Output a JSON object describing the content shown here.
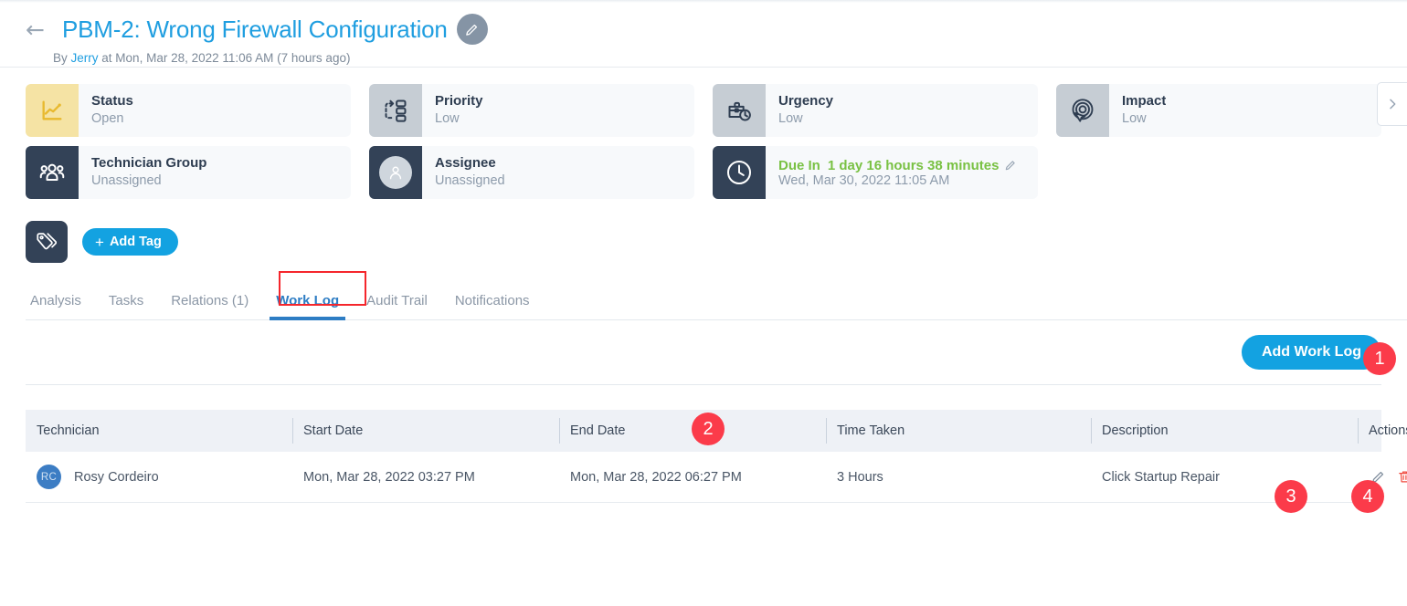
{
  "header": {
    "back_icon": "back-arrow-icon",
    "title": "PBM-2: Wrong Firewall Configuration",
    "edit_icon": "pencil-icon",
    "byline_prefix": "By",
    "author": "Jerry",
    "byline_suffix": "at Mon, Mar 28, 2022 11:06 AM (7 hours ago)"
  },
  "cards": {
    "row1": [
      {
        "label": "Status",
        "value": "Open",
        "icon": "line-chart-icon",
        "icon_style": "yellow"
      },
      {
        "label": "Priority",
        "value": "Low",
        "icon": "priority-flow-icon",
        "icon_style": "grey"
      },
      {
        "label": "Urgency",
        "value": "Low",
        "icon": "briefcase-clock-icon",
        "icon_style": "grey"
      },
      {
        "label": "Impact",
        "value": "Low",
        "icon": "target-cursor-icon",
        "icon_style": "grey"
      }
    ],
    "row2": [
      {
        "label": "Technician Group",
        "value": "Unassigned",
        "icon": "users-group-icon",
        "icon_style": "dark"
      },
      {
        "label": "Assignee",
        "value": "Unassigned",
        "icon": "user-avatar-icon",
        "icon_style": "dark"
      }
    ],
    "due": {
      "icon": "clock-icon",
      "label_prefix": "Due In",
      "label_value": "1 day 16 hours 38 minutes",
      "edit_icon": "pencil-icon",
      "date": "Wed, Mar 30, 2022 11:05 AM"
    },
    "next_icon": "chevron-right-icon"
  },
  "tag_row": {
    "icon": "tag-icon",
    "add_tag_plus": "+",
    "add_tag_label": "Add Tag"
  },
  "tabs": [
    {
      "label": "Analysis",
      "active": false
    },
    {
      "label": "Tasks",
      "active": false
    },
    {
      "label": "Relations (1)",
      "active": false
    },
    {
      "label": "Work Log",
      "active": true
    },
    {
      "label": "Audit Trail",
      "active": false
    },
    {
      "label": "Notifications",
      "active": false
    }
  ],
  "worklog": {
    "add_button_label": "Add Work Log",
    "columns": [
      "Technician",
      "Start Date",
      "End Date",
      "Time Taken",
      "Description",
      "Actions"
    ],
    "rows": [
      {
        "initials": "RC",
        "technician": "Rosy Cordeiro",
        "start_date": "Mon, Mar 28, 2022 03:27 PM",
        "end_date": "Mon, Mar 28, 2022 06:27 PM",
        "time_taken": "3 Hours",
        "description": "Click Startup Repair",
        "edit_icon": "pencil-icon",
        "delete_icon": "trash-icon"
      }
    ]
  },
  "annotations": [
    {
      "number": "1"
    },
    {
      "number": "2"
    },
    {
      "number": "3"
    },
    {
      "number": "4"
    }
  ],
  "colors": {
    "accent_blue": "#13a2e1",
    "title_blue": "#1f9ee0",
    "tab_active": "#2e7dc4",
    "due_green": "#79c143",
    "badge_red": "#fb3b4a",
    "dark_navy": "#334257",
    "status_yellow": "#f5e3a4"
  }
}
